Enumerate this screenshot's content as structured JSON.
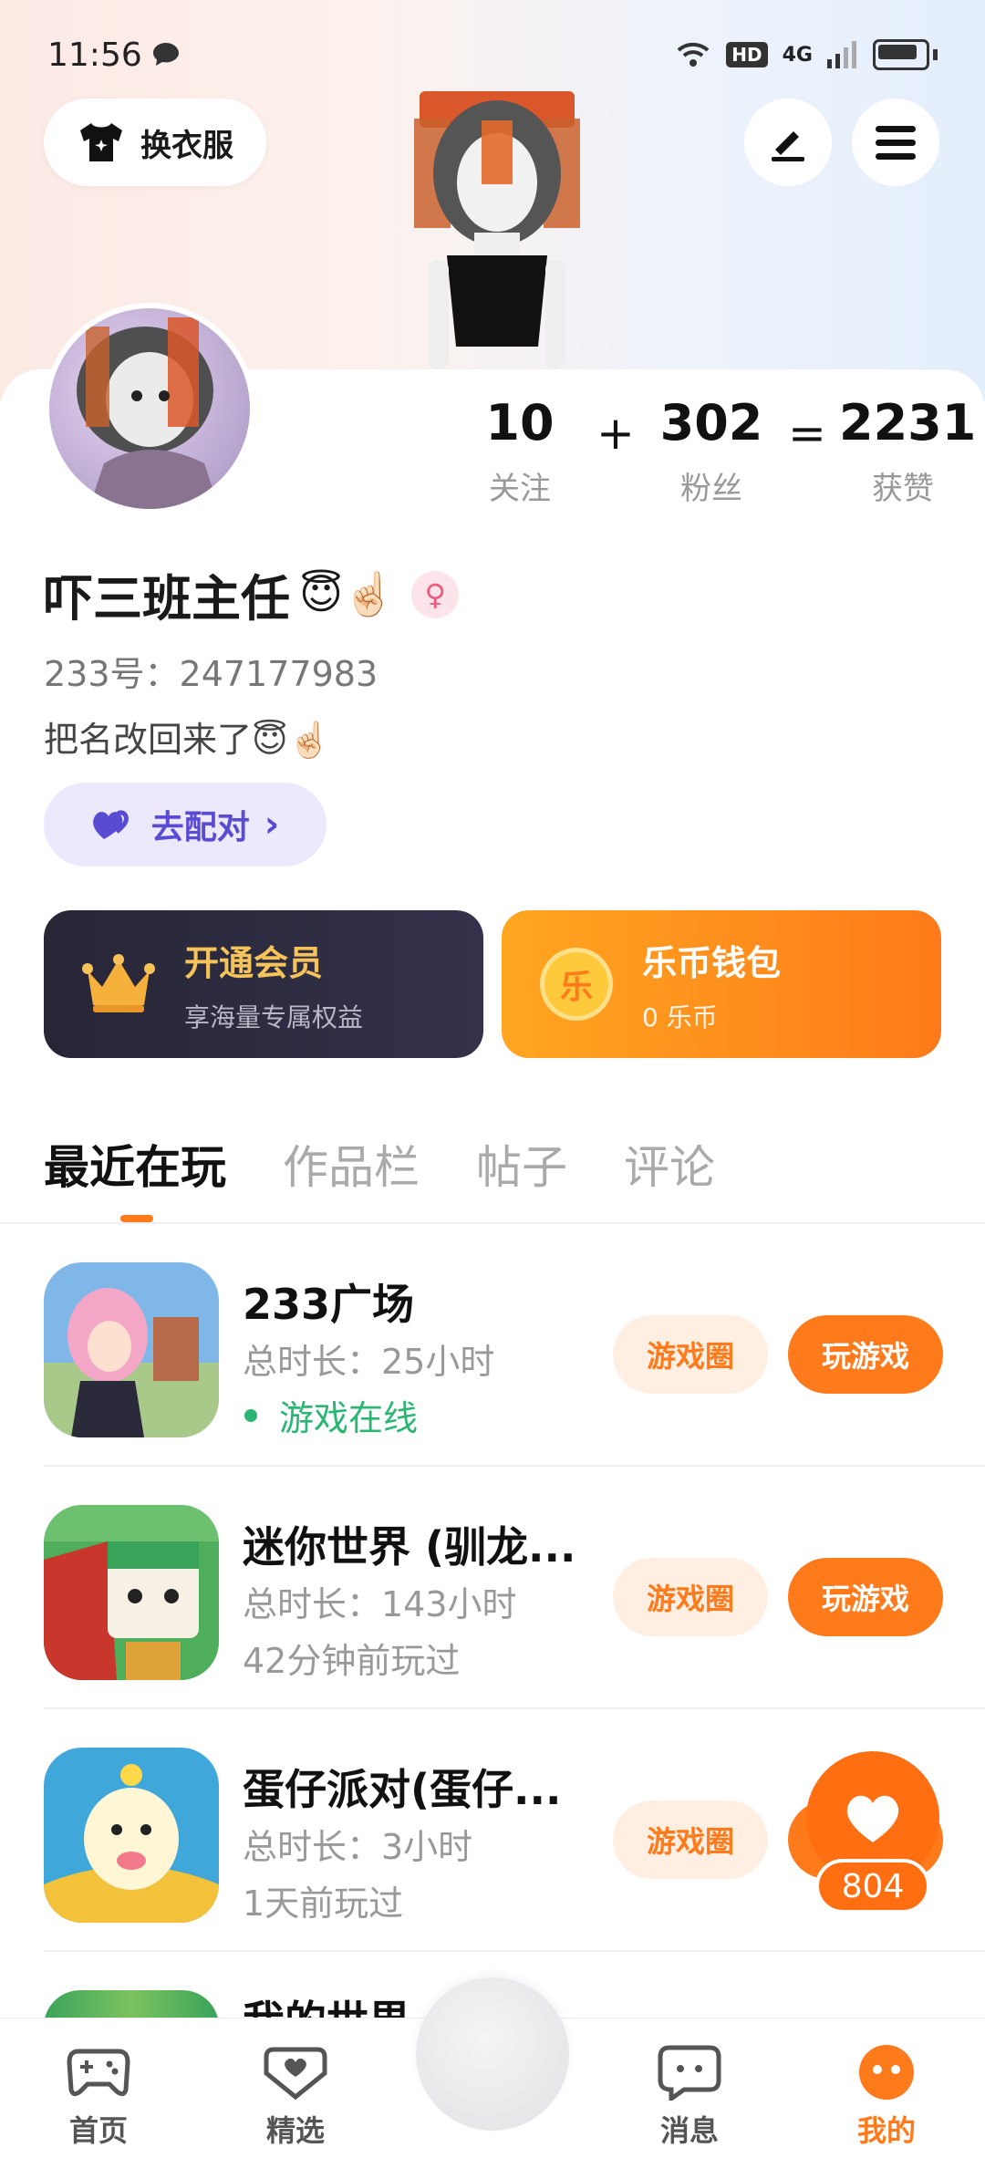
{
  "status_bar": {
    "time": "11:56",
    "network": "4G",
    "hd": "HD"
  },
  "header": {
    "outfit_label": "换衣服"
  },
  "profile": {
    "stats": [
      {
        "value": "10",
        "label": "关注"
      },
      {
        "value": "302",
        "label": "粉丝"
      },
      {
        "value": "2231",
        "label": "获赞"
      }
    ],
    "stat_ops": [
      "+",
      "="
    ],
    "name": "吓三班主任",
    "name_emoji": "😇☝🏻",
    "gender_symbol": "♀",
    "uid": "233号：247177983",
    "bio": "把名改回来了",
    "bio_emoji": "😇☝🏻",
    "match_label": "去配对",
    "match_chevron": "›"
  },
  "promos": {
    "vip": {
      "title": "开通会员",
      "subtitle": "享海量专属权益"
    },
    "wallet": {
      "title": "乐币钱包",
      "subtitle": "0 乐币",
      "coin_char": "乐"
    }
  },
  "tabs": [
    {
      "label": "最近在玩",
      "active": true
    },
    {
      "label": "作品栏",
      "active": false
    },
    {
      "label": "帖子",
      "active": false
    },
    {
      "label": "评论",
      "active": false
    }
  ],
  "games": [
    {
      "title": "233广场",
      "time": "总时长：25小时",
      "status": "游戏在线",
      "online": true,
      "circle_label": "游戏圈",
      "play_label": "玩游戏"
    },
    {
      "title": "迷你世界 (驯龙...",
      "time": "总时长：143小时",
      "status": "42分钟前玩过",
      "online": false,
      "circle_label": "游戏圈",
      "play_label": "玩游戏"
    },
    {
      "title": "蛋仔派对(蛋仔...",
      "time": "总时长：3小时",
      "status": "1天前玩过",
      "online": false,
      "circle_label": "游戏圈",
      "play_label": "玩游戏"
    }
  ],
  "peek_game_title": "我的世界",
  "like_float": {
    "count": "804"
  },
  "bottom_nav": [
    {
      "label": "首页",
      "icon": "gamepad-icon",
      "active": false
    },
    {
      "label": "精选",
      "icon": "heart-box-icon",
      "active": false
    },
    {
      "label": "消息",
      "icon": "chat-icon",
      "active": false
    },
    {
      "label": "我的",
      "icon": "profile-face-icon",
      "active": true
    }
  ],
  "colors": {
    "accent": "#ff7a1a",
    "online": "#2bb673",
    "match": "#5a4bd3",
    "vip_bg": "#2a283a"
  }
}
